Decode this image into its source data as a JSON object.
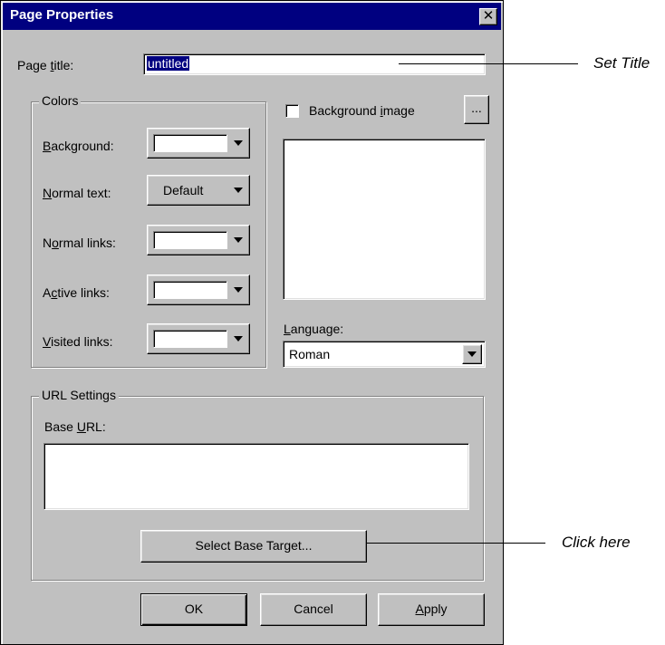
{
  "dialog": {
    "title": "Page Properties",
    "close_glyph": "✕"
  },
  "page_title": {
    "label_before": "Page ",
    "label_key": "t",
    "label_after": "itle:",
    "value": "untitled"
  },
  "colors_group": {
    "title": "Colors",
    "rows": [
      {
        "key": "B",
        "rest": "ackground:",
        "value": "",
        "kind": "swatch"
      },
      {
        "key": "N",
        "rest": "ormal text:",
        "value": "Default",
        "kind": "default"
      },
      {
        "key_before": "N",
        "key": "o",
        "rest": "rmal links:",
        "value": "",
        "kind": "swatch"
      },
      {
        "key_before": "A",
        "key": "c",
        "rest": "tive links:",
        "value": "",
        "kind": "swatch"
      },
      {
        "key": "V",
        "rest": "isited links:",
        "value": "",
        "kind": "swatch"
      }
    ]
  },
  "background_image": {
    "label_before": "Background ",
    "label_key": "i",
    "label_after": "mage",
    "checked": false,
    "browse_label": "..."
  },
  "language": {
    "label_key": "L",
    "label_after": "anguage:",
    "selected": "Roman"
  },
  "url_group": {
    "title": "URL Settings",
    "base_label_before": "Base ",
    "base_label_key": "U",
    "base_label_after": "RL:",
    "base_url_value": "",
    "select_target_label": "Select Base Target..."
  },
  "footer": {
    "ok_label": "OK",
    "cancel_label": "Cancel",
    "apply_key": "A",
    "apply_after": "pply"
  },
  "callouts": {
    "set_title": "Set Title",
    "click_here": "Click here"
  },
  "colors": {
    "face": "#c0c0c0",
    "titlebar": "#000080",
    "highlight": "#000080"
  }
}
